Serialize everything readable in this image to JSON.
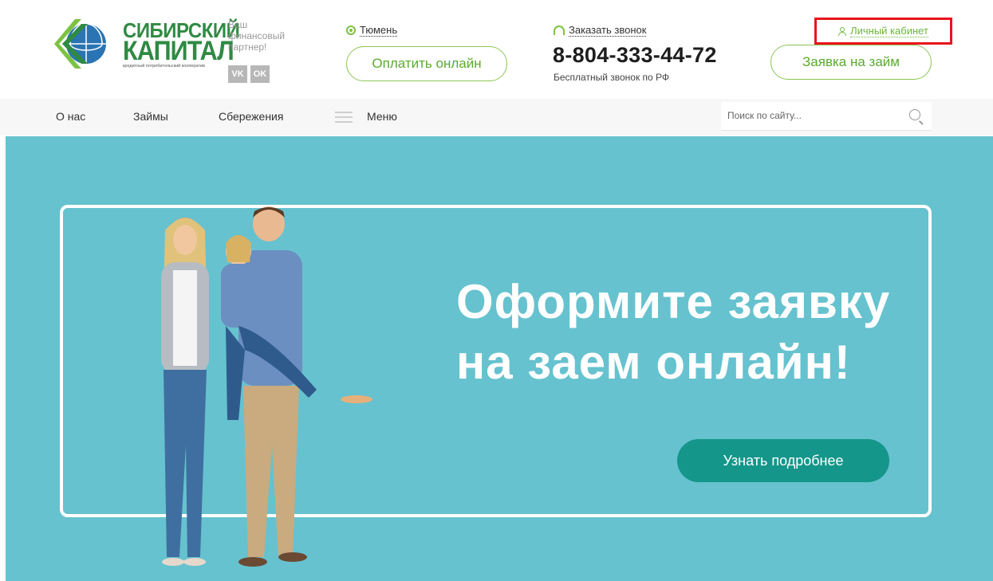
{
  "header": {
    "brand_line1": "СИБИРСКИЙ",
    "brand_line2": "КАПИТАЛ",
    "brand_line3": "кредитный потребительский кооператив",
    "tagline": "Ваш финансовый партнер!",
    "social": [
      "VK",
      "OK"
    ],
    "city": "Тюмень",
    "pay_label": "Оплатить онлайн",
    "callback_label": "Заказать звонок",
    "phone": "8-804-333-44-72",
    "phone_note": "Бесплатный звонок по РФ",
    "cabinet_label": "Личный кабинет",
    "loan_label": "Заявка на займ"
  },
  "nav": {
    "items": [
      "О нас",
      "Займы",
      "Сбережения"
    ],
    "menu_label": "Меню",
    "search_placeholder": "Поиск по сайту..."
  },
  "hero": {
    "title_line1": "Оформите заявку",
    "title_line2": "на заем онлайн!",
    "button_label": "Узнать подробнее"
  },
  "colors": {
    "brand_green": "#2f8a43",
    "accent_green": "#8cc654",
    "hero_bg": "#66c2cf",
    "button_teal": "#14968a",
    "highlight_red": "#e8141b"
  }
}
